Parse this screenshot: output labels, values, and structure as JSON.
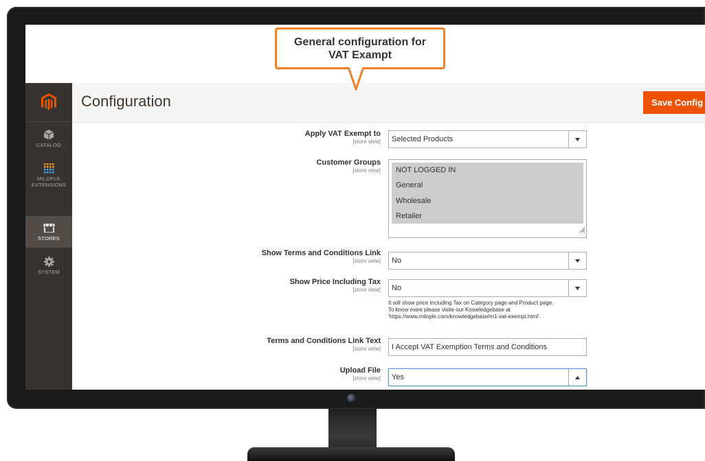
{
  "callout": {
    "line1": "General configuration for",
    "line2": "VAT Exampt"
  },
  "header": {
    "title": "Configuration",
    "save_label": "Save Config"
  },
  "sidebar": {
    "logo": "magento-logo-icon",
    "items": [
      {
        "label": "CATALOG",
        "icon": "cube-icon",
        "active": false
      },
      {
        "label": "MILOPLE EXTENSIONS",
        "icon": "grid-dots-icon",
        "active": false
      },
      {
        "label": "STORES",
        "icon": "store-icon",
        "active": true
      },
      {
        "label": "SYSTEM",
        "icon": "gear-icon",
        "active": false
      }
    ]
  },
  "form": {
    "apply_vat": {
      "label": "Apply VAT Exempt to",
      "scope": "[store view]",
      "value": "Selected Products"
    },
    "customer_groups": {
      "label": "Customer Groups",
      "scope": "[store view]",
      "options": [
        "NOT LOGGED IN",
        "General",
        "Wholesale",
        "Retailer"
      ]
    },
    "show_terms": {
      "label": "Show Terms and Conditions Link",
      "scope": "[store view]",
      "value": "No"
    },
    "show_price_tax": {
      "label": "Show Price Including Tax",
      "scope": "[store view]",
      "value": "No",
      "note1": "It will show price Including Tax on Category page and Product page.",
      "note2": "To know more please visite our Knowledgebase at",
      "note3": "'https://www.milople.com/knowledgebase/m1-vat-exempt.html'."
    },
    "terms_text": {
      "label": "Terms and Conditions Link Text",
      "scope": "[store view]",
      "value": "I Accept VAT Exemption Terms and Conditions"
    },
    "upload_file": {
      "label": "Upload File",
      "scope": "[store view]",
      "value": "Yes"
    }
  },
  "colors": {
    "accent": "#eb5202",
    "sidebar": "#373330",
    "callout_border": "#f08229"
  }
}
